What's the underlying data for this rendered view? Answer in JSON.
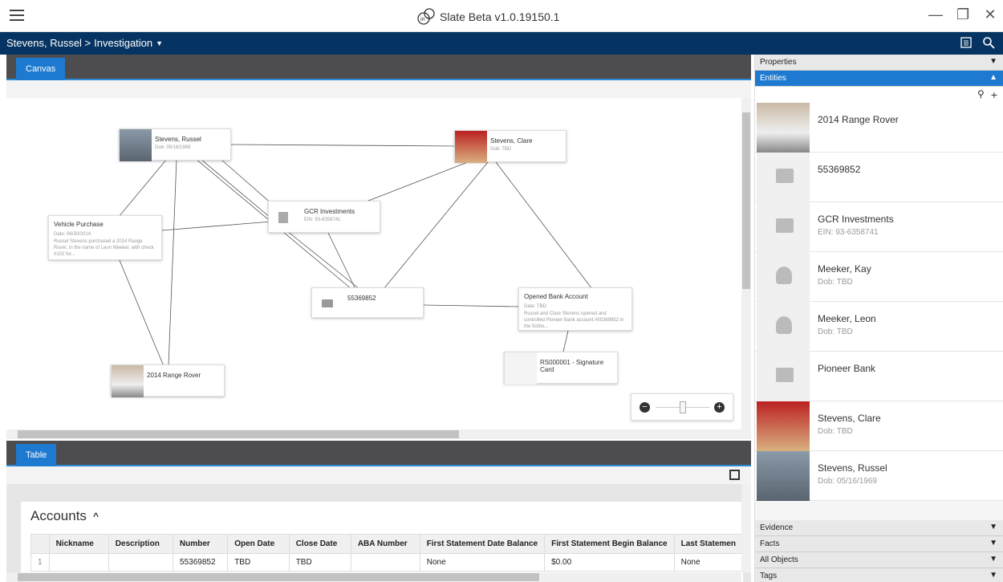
{
  "app": {
    "title": "Slate Beta v1.0.19150.1"
  },
  "nav": {
    "crumb_parent": "Stevens, Russel >",
    "crumb_current": "Investigation"
  },
  "canvas": {
    "tab_label": "Canvas",
    "nodes": {
      "russel": {
        "title": "Stevens, Russel",
        "sub": "Dob: 05/16/1969"
      },
      "clare": {
        "title": "Stevens, Clare",
        "sub": "Dob: TBD"
      },
      "gcr": {
        "title": "GCR Investments",
        "sub": "EIN: 93-6358741"
      },
      "vehicle": {
        "title": "Vehicle Purchase",
        "date": "Date: 06/30/2014",
        "desc": "Russel Stevens purchased a 2014 Range Rover, in the name of Leon Meeker, with check #102 for..."
      },
      "account": {
        "title": "55369852"
      },
      "opened": {
        "title": "Opened Bank Account",
        "date": "Date: TBD",
        "desc": "Russel and Clare Stevens opened and controlled Pioneer Bank account #55369852 in the fictitio..."
      },
      "signature": {
        "title": "RS000001 - Signature Card"
      },
      "rover": {
        "title": "2014 Range Rover"
      }
    }
  },
  "table": {
    "tab_label": "Table",
    "section_title": "Accounts",
    "columns": [
      "Nickname",
      "Description",
      "Number",
      "Open Date",
      "Close Date",
      "ABA Number",
      "First Statement Date Balance",
      "First Statement Begin Balance",
      "Last Statemen"
    ],
    "rows": [
      {
        "idx": "1",
        "cells": [
          "",
          "",
          "55369852",
          "TBD",
          "TBD",
          "",
          "None",
          "$0.00",
          "None"
        ]
      }
    ]
  },
  "right_panel": {
    "properties_label": "Properties",
    "entities_label": "Entities",
    "entities": [
      {
        "name": "2014 Range Rover",
        "sub": ""
      },
      {
        "name": "55369852",
        "sub": ""
      },
      {
        "name": "GCR Investments",
        "sub": "EIN: 93-6358741"
      },
      {
        "name": "Meeker, Kay",
        "sub": "Dob: TBD"
      },
      {
        "name": "Meeker, Leon",
        "sub": "Dob: TBD"
      },
      {
        "name": "Pioneer Bank",
        "sub": ""
      },
      {
        "name": "Stevens, Clare",
        "sub": "Dob: TBD"
      },
      {
        "name": "Stevens, Russel",
        "sub": "Dob: 05/16/1969"
      }
    ],
    "bottom_sections": [
      "Evidence",
      "Facts",
      "All Objects",
      "Tags"
    ]
  }
}
